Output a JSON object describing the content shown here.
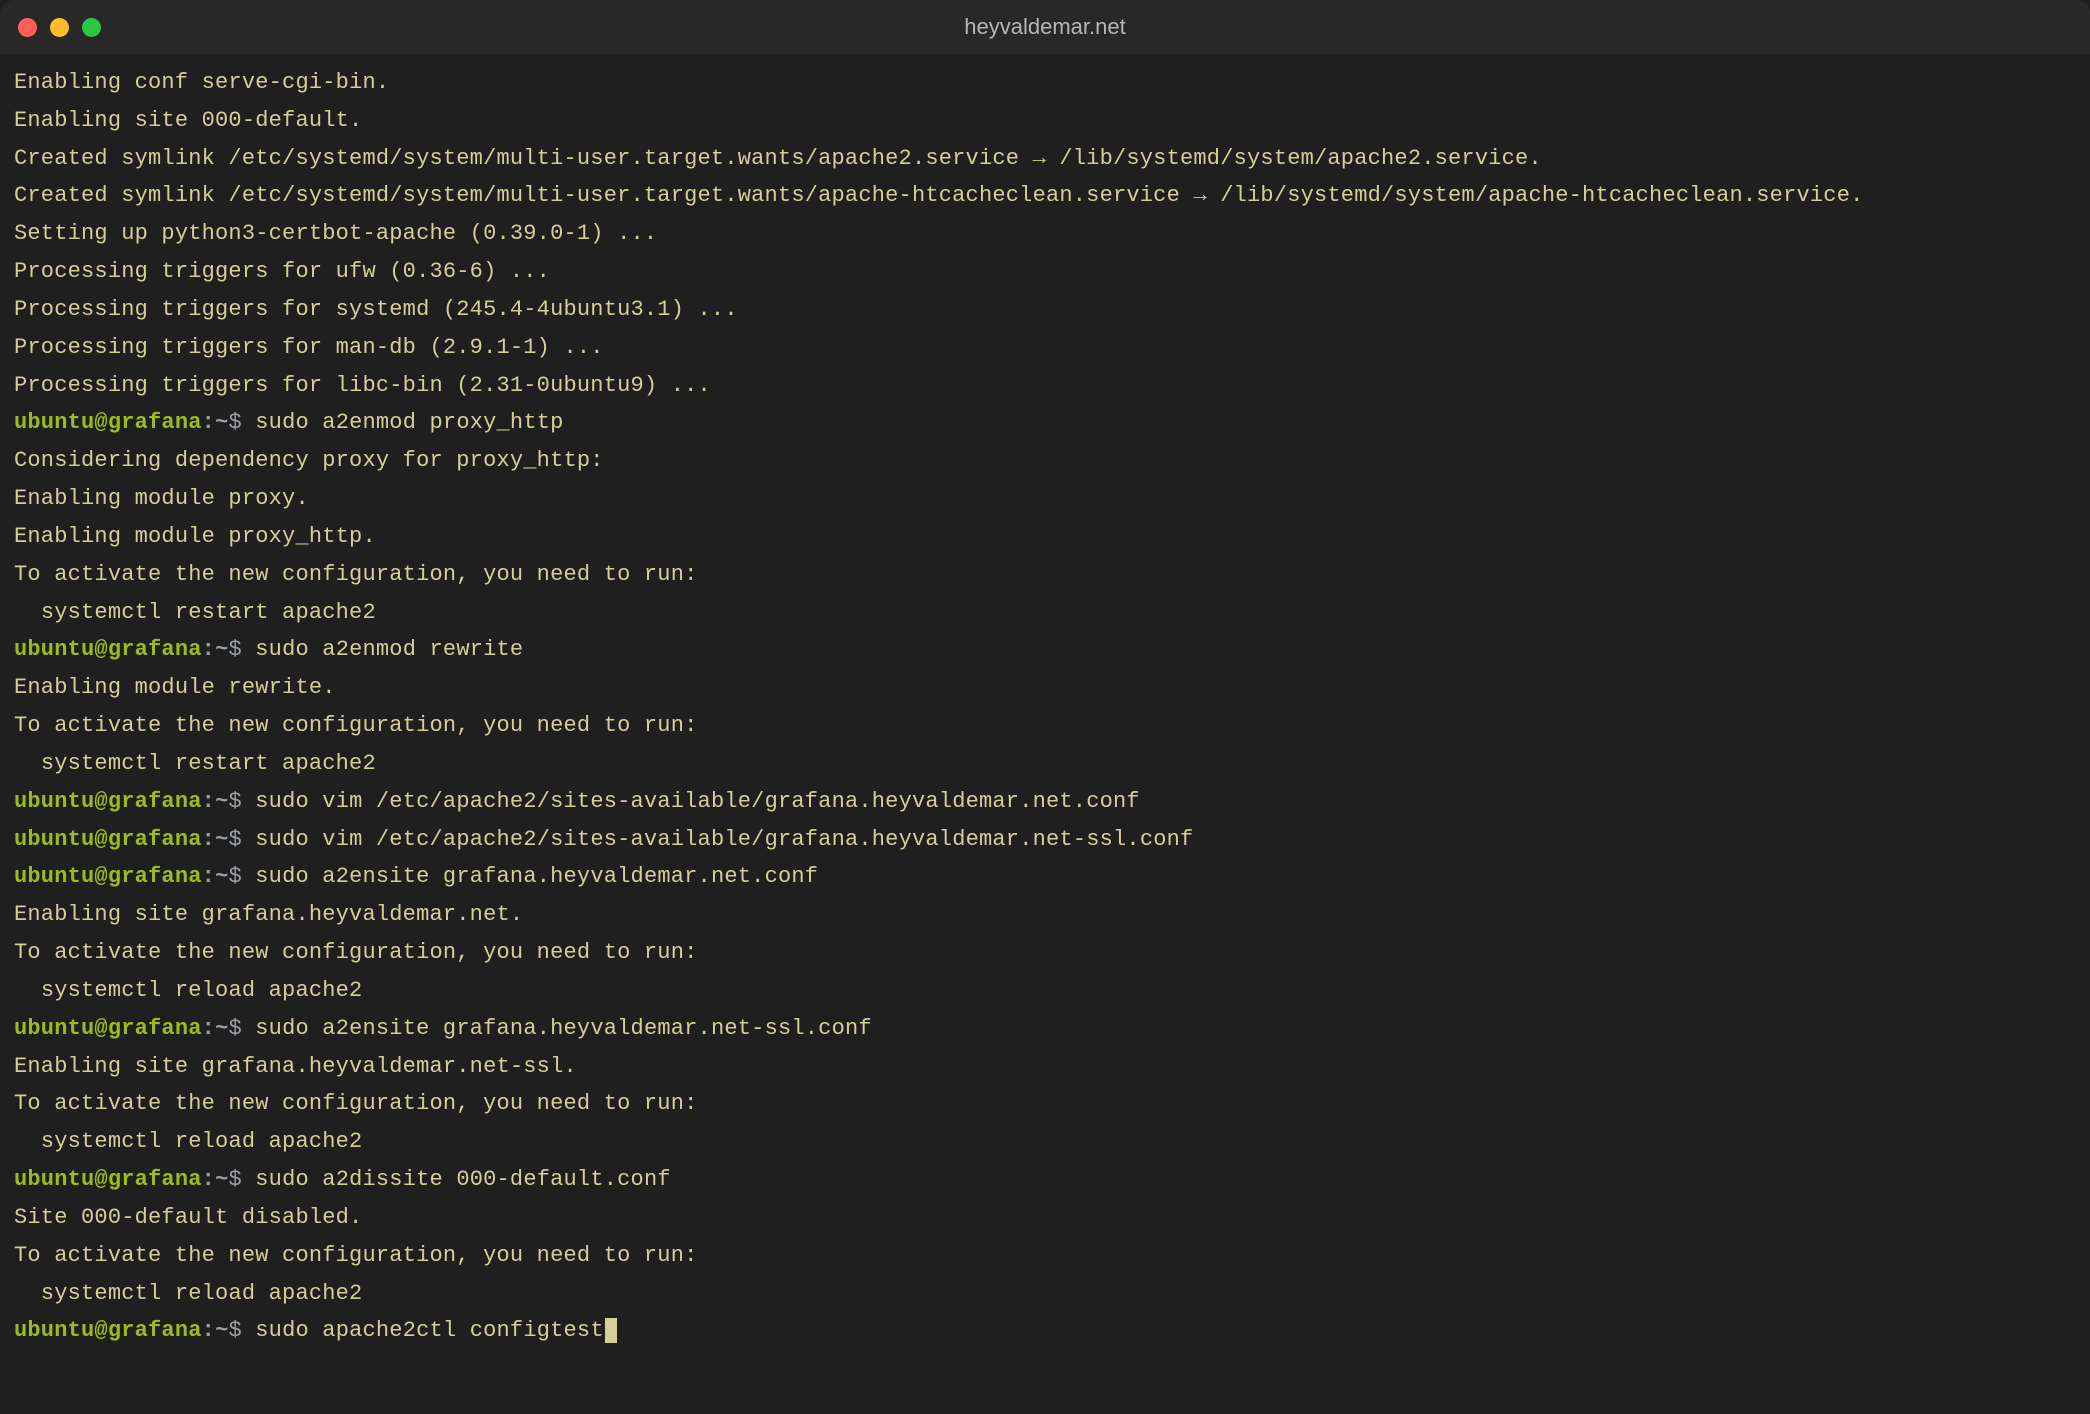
{
  "window": {
    "title": "heyvaldemar.net"
  },
  "prompt": {
    "user": "ubuntu",
    "at": "@",
    "host": "grafana",
    "colon": ":",
    "path": "~",
    "symbol": "$"
  },
  "colors": {
    "bg": "#1f1f1f",
    "fg": "#d6ce99",
    "userhost": "#9bbc1f",
    "traffic_close": "#ff5f57",
    "traffic_min": "#febc2e",
    "traffic_zoom": "#28c840"
  },
  "history": [
    {
      "type": "output",
      "text": "Enabling conf serve-cgi-bin."
    },
    {
      "type": "output",
      "text": "Enabling site 000-default."
    },
    {
      "type": "output",
      "text": "Created symlink /etc/systemd/system/multi-user.target.wants/apache2.service → /lib/systemd/system/apache2.service."
    },
    {
      "type": "output",
      "text": "Created symlink /etc/systemd/system/multi-user.target.wants/apache-htcacheclean.service → /lib/systemd/system/apache-htcacheclean.service."
    },
    {
      "type": "output",
      "text": "Setting up python3-certbot-apache (0.39.0-1) ..."
    },
    {
      "type": "output",
      "text": "Processing triggers for ufw (0.36-6) ..."
    },
    {
      "type": "output",
      "text": "Processing triggers for systemd (245.4-4ubuntu3.1) ..."
    },
    {
      "type": "output",
      "text": "Processing triggers for man-db (2.9.1-1) ..."
    },
    {
      "type": "output",
      "text": "Processing triggers for libc-bin (2.31-0ubuntu9) ..."
    },
    {
      "type": "command",
      "text": "sudo a2enmod proxy_http"
    },
    {
      "type": "output",
      "text": "Considering dependency proxy for proxy_http:"
    },
    {
      "type": "output",
      "text": "Enabling module proxy."
    },
    {
      "type": "output",
      "text": "Enabling module proxy_http."
    },
    {
      "type": "output",
      "text": "To activate the new configuration, you need to run:"
    },
    {
      "type": "output",
      "text": "  systemctl restart apache2"
    },
    {
      "type": "command",
      "text": "sudo a2enmod rewrite"
    },
    {
      "type": "output",
      "text": "Enabling module rewrite."
    },
    {
      "type": "output",
      "text": "To activate the new configuration, you need to run:"
    },
    {
      "type": "output",
      "text": "  systemctl restart apache2"
    },
    {
      "type": "command",
      "text": "sudo vim /etc/apache2/sites-available/grafana.heyvaldemar.net.conf"
    },
    {
      "type": "command",
      "text": "sudo vim /etc/apache2/sites-available/grafana.heyvaldemar.net-ssl.conf"
    },
    {
      "type": "command",
      "text": "sudo a2ensite grafana.heyvaldemar.net.conf"
    },
    {
      "type": "output",
      "text": "Enabling site grafana.heyvaldemar.net."
    },
    {
      "type": "output",
      "text": "To activate the new configuration, you need to run:"
    },
    {
      "type": "output",
      "text": "  systemctl reload apache2"
    },
    {
      "type": "command",
      "text": "sudo a2ensite grafana.heyvaldemar.net-ssl.conf"
    },
    {
      "type": "output",
      "text": "Enabling site grafana.heyvaldemar.net-ssl."
    },
    {
      "type": "output",
      "text": "To activate the new configuration, you need to run:"
    },
    {
      "type": "output",
      "text": "  systemctl reload apache2"
    },
    {
      "type": "command",
      "text": "sudo a2dissite 000-default.conf"
    },
    {
      "type": "output",
      "text": "Site 000-default disabled."
    },
    {
      "type": "output",
      "text": "To activate the new configuration, you need to run:"
    },
    {
      "type": "output",
      "text": "  systemctl reload apache2"
    }
  ],
  "current": {
    "command": "sudo apache2ctl configtest"
  }
}
